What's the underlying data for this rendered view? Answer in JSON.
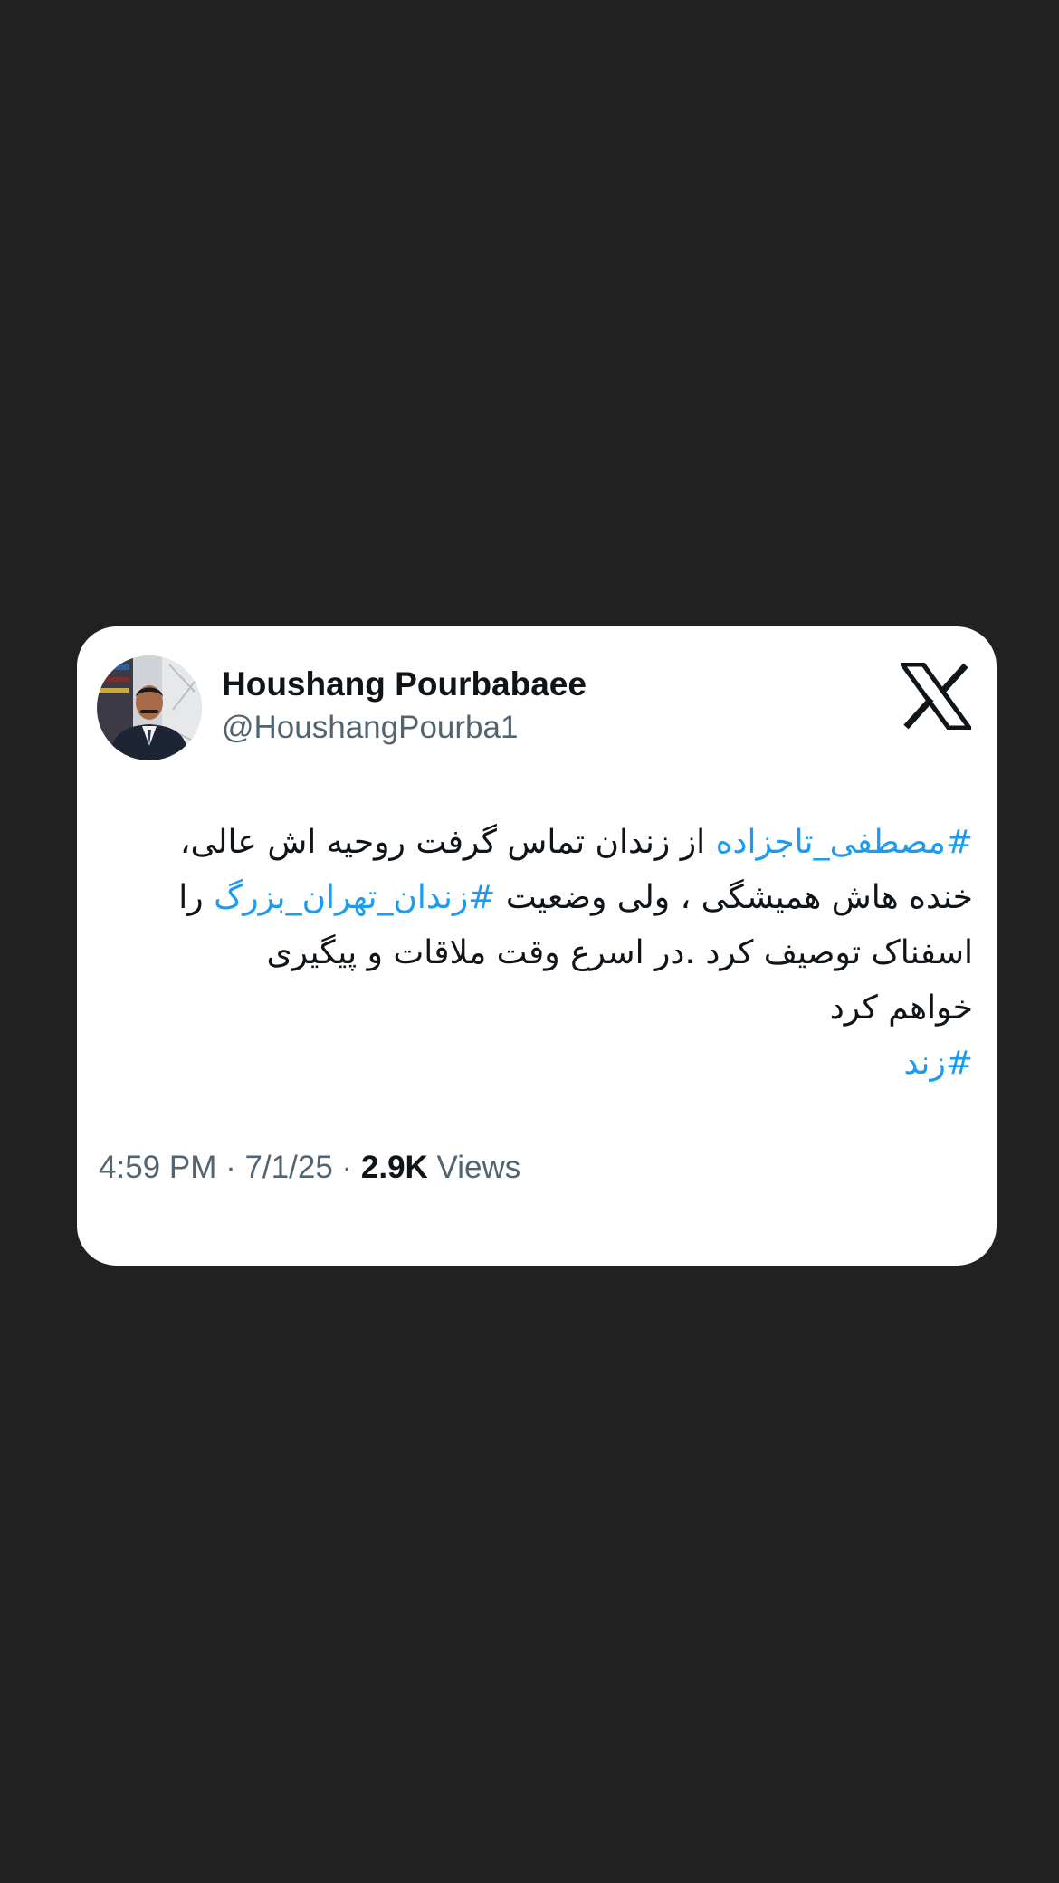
{
  "tweet": {
    "author": {
      "display_name": "Houshang Pourbabaee",
      "handle": "@HoushangPourba1"
    },
    "platform_icon": "x-logo-icon",
    "body": {
      "line1": {
        "hashtag": "#مصطفی_تاجزاده",
        "text": " از زندان تماس گرفت روحیه اش عالی،"
      },
      "line2": {
        "text_before": "خنده هاش همیشگی ، ولی وضعیت ",
        "hashtag": "#زندان_تهران_بزرگ",
        "text_after": " را"
      },
      "line3": "اسفناک توصیف کرد .در اسرع وقت ملاقات و پیگیری",
      "line4": "خواهم کرد",
      "line5_hashtag": "#زند"
    },
    "meta": {
      "time": "4:59 PM",
      "separator": " · ",
      "date": "7/1/25",
      "views_count": "2.9K",
      "views_label": " Views"
    }
  },
  "colors": {
    "background": "#212121",
    "card": "#ffffff",
    "text": "#0f1419",
    "secondary": "#536471",
    "link": "#1d9bf0"
  }
}
